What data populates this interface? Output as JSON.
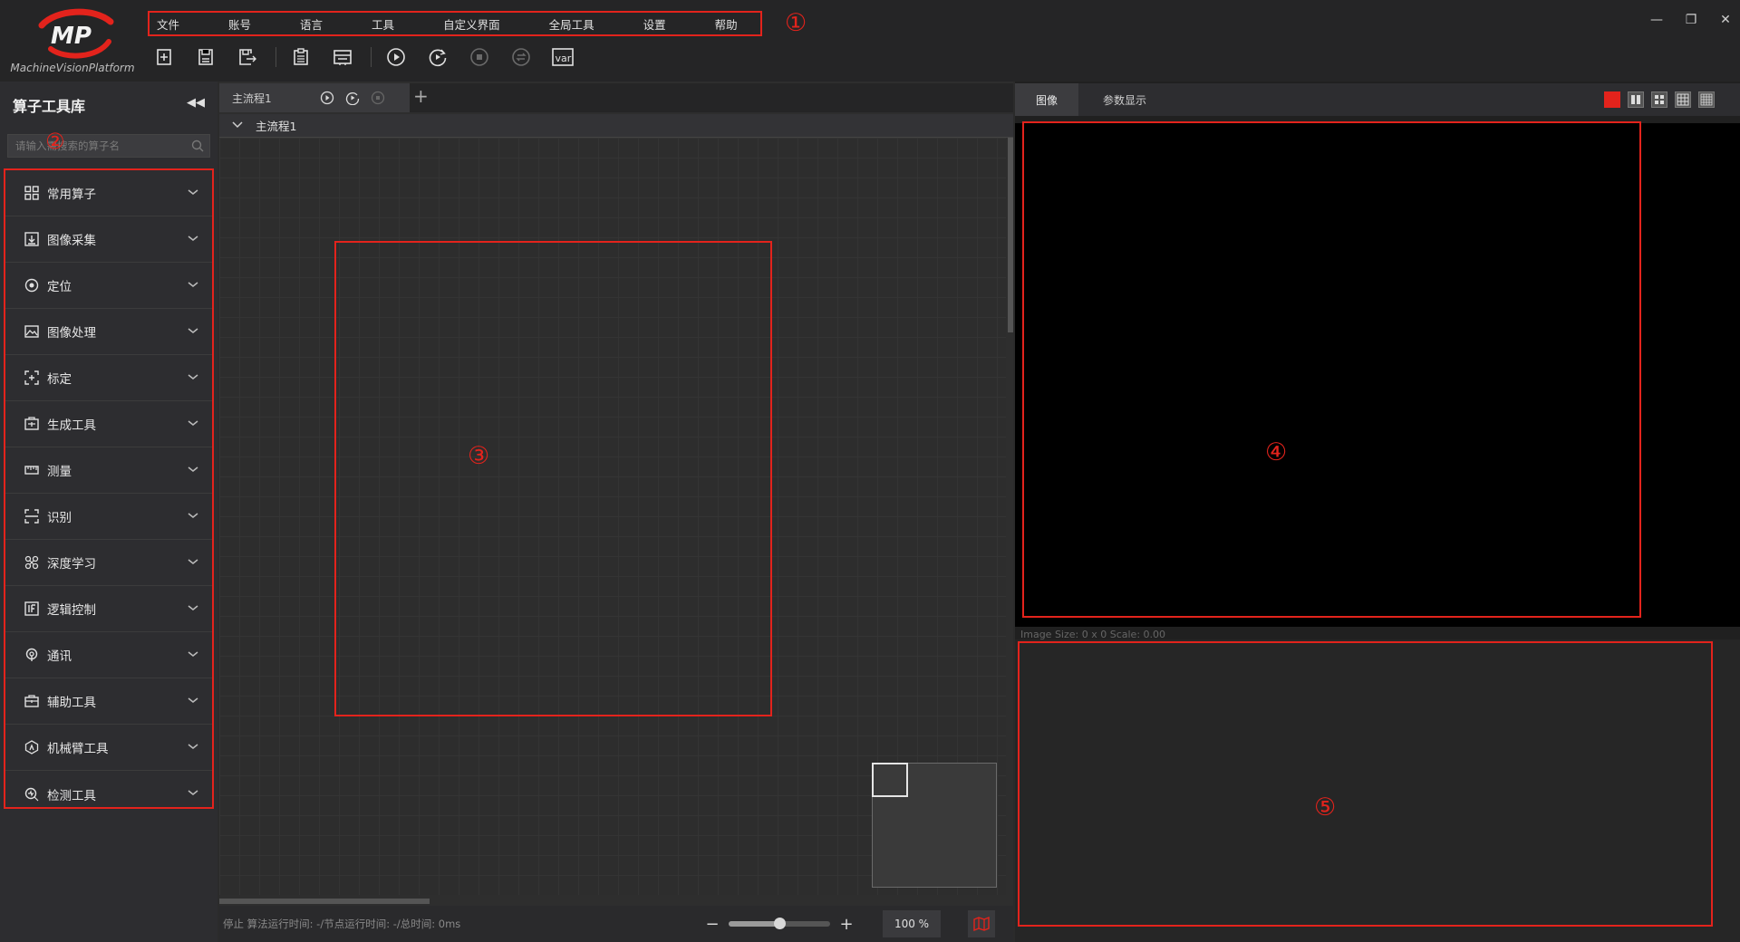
{
  "app": {
    "logo_text": "MachineVisionPlatform",
    "accent_color": "#e3231c"
  },
  "menu": {
    "items": [
      "文件",
      "账号",
      "语言",
      "工具",
      "自定义界面",
      "全局工具",
      "设置",
      "帮助"
    ]
  },
  "callouts": [
    "①",
    "②",
    "③",
    "④",
    "⑤"
  ],
  "toolbar": {
    "buttons": [
      "new-solution-icon",
      "save-icon",
      "save-as-icon",
      "clipboard-icon",
      "layout-icon",
      "run-once-icon",
      "run-loop-icon",
      "stop-icon",
      "switch-icon",
      "var-icon"
    ],
    "var_label": "var"
  },
  "window_controls": [
    "—",
    "❐",
    "✕"
  ],
  "sidebar": {
    "title": "算子工具库",
    "search_placeholder": "请输入需搜索的算子名",
    "categories": [
      {
        "label": "常用算子",
        "icon": "grid-icon"
      },
      {
        "label": "图像采集",
        "icon": "image-acquire-icon"
      },
      {
        "label": "定位",
        "icon": "locate-icon"
      },
      {
        "label": "图像处理",
        "icon": "image-process-icon"
      },
      {
        "label": "标定",
        "icon": "calibrate-icon"
      },
      {
        "label": "生成工具",
        "icon": "generate-icon"
      },
      {
        "label": "测量",
        "icon": "ruler-icon"
      },
      {
        "label": "识别",
        "icon": "scan-icon"
      },
      {
        "label": "深度学习",
        "icon": "deep-learning-icon"
      },
      {
        "label": "逻辑控制",
        "icon": "logic-icon"
      },
      {
        "label": "通讯",
        "icon": "comm-icon"
      },
      {
        "label": "辅助工具",
        "icon": "toolbox-icon"
      },
      {
        "label": "机械臂工具",
        "icon": "robot-arm-icon"
      },
      {
        "label": "检测工具",
        "icon": "inspect-icon"
      }
    ]
  },
  "flow": {
    "tab_label": "主流程1",
    "header_label": "主流程1",
    "add_tab": "+"
  },
  "status": {
    "text": "停止 算法运行时间: -/节点运行时间: -/总时间: 0ms",
    "zoom_minus": "−",
    "zoom_plus": "+",
    "zoom_value": "100 %",
    "zoom_level": 0.5
  },
  "right": {
    "tabs": [
      "图像",
      "参数显示"
    ],
    "image_info": "Image Size: 0 x 0 Scale: 0.00",
    "layout_buttons": [
      "layout-1-icon",
      "layout-2-icon",
      "layout-4-icon",
      "layout-9-icon",
      "layout-16-icon"
    ]
  }
}
